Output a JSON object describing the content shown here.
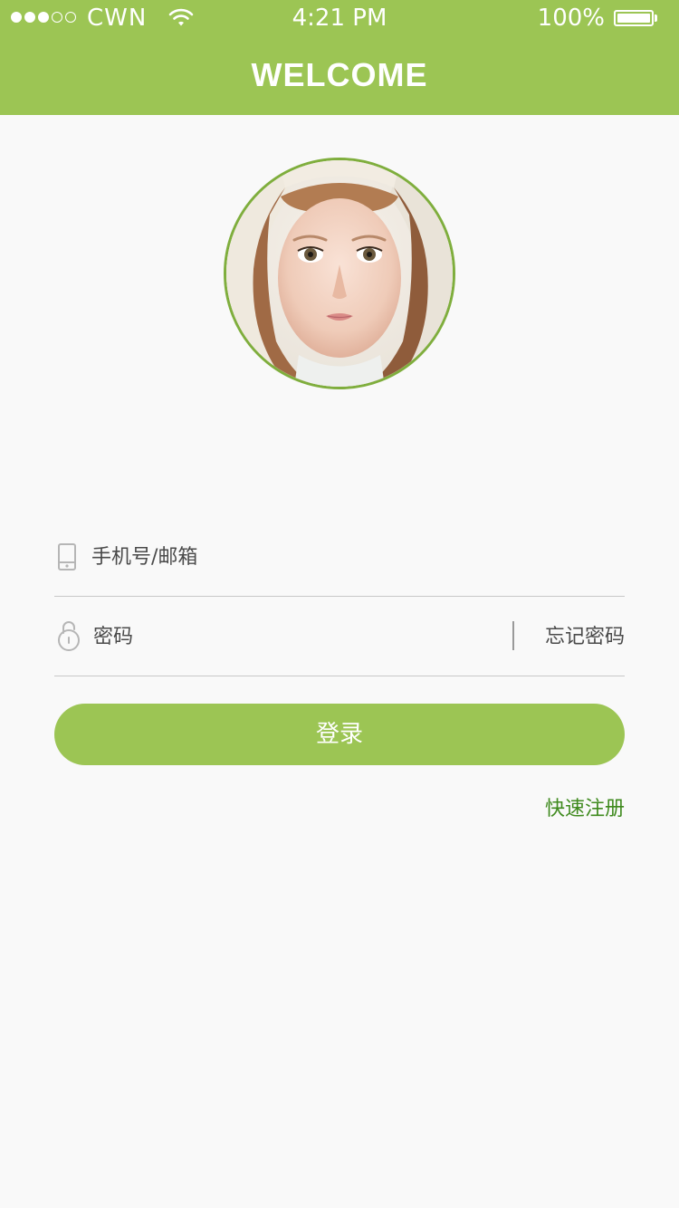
{
  "status_bar": {
    "carrier": "CWN",
    "time": "4:21 PM",
    "battery": "100%"
  },
  "header": {
    "title": "WELCOME"
  },
  "form": {
    "account_placeholder": "手机号/邮箱",
    "password_placeholder": "密码",
    "forgot_label": "忘记密码",
    "login_label": "登录",
    "register_label": "快速注册"
  },
  "colors": {
    "brand_green": "#9cc554",
    "link_green": "#3f8a1e",
    "background": "#f9f9f9"
  },
  "icons": {
    "account": "phone-icon",
    "password": "lock-icon"
  }
}
